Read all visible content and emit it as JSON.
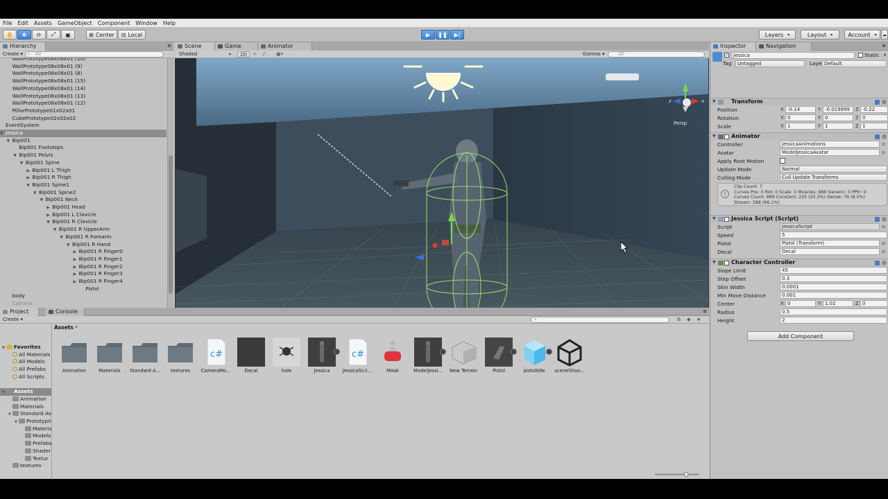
{
  "menu": [
    "File",
    "Edit",
    "Assets",
    "GameObject",
    "Component",
    "Window",
    "Help"
  ],
  "toolbar": {
    "pivot_label": "Center",
    "space_label": "Local",
    "layers_label": "Layers",
    "layout_label": "Layout",
    "account_label": "Account"
  },
  "hierarchy": {
    "tab_label": "Hierarchy",
    "create_label": "Create",
    "search_placeholder": "All",
    "rows": [
      {
        "label": "WallPrototype08x08x01 (10)",
        "indent": 1
      },
      {
        "label": "WallPrototype08x08x01 (9)",
        "indent": 1
      },
      {
        "label": "WallPrototype08x08x01 (8)",
        "indent": 1
      },
      {
        "label": "WallPrototype08x08x01 (15)",
        "indent": 1
      },
      {
        "label": "WallPrototype08x08x01 (14)",
        "indent": 1
      },
      {
        "label": "WallPrototype08x08x01 (13)",
        "indent": 1
      },
      {
        "label": "WallPrototype08x08x01 (12)",
        "indent": 1
      },
      {
        "label": "PillarPrototype01x02x01",
        "indent": 1
      },
      {
        "label": "CubePrototype02x02x02",
        "indent": 1
      },
      {
        "label": "EventSystem",
        "indent": 0
      },
      {
        "label": "Jessica",
        "indent": 0
      },
      {
        "label": "Bip001",
        "indent": 1
      },
      {
        "label": "Bip001 Footsteps",
        "indent": 2
      },
      {
        "label": "Bip001 Pelvis",
        "indent": 2
      },
      {
        "label": "Bip001 Spine",
        "indent": 3
      },
      {
        "label": "Bip001 L Thigh",
        "indent": 4
      },
      {
        "label": "Bip001 R Thigh",
        "indent": 4
      },
      {
        "label": "Bip001 Spine1",
        "indent": 4
      },
      {
        "label": "Bip001 Spine2",
        "indent": 5
      },
      {
        "label": "Bip001 Neck",
        "indent": 6
      },
      {
        "label": "Bip001 Head",
        "indent": 7
      },
      {
        "label": "Bip001 L Clavicle",
        "indent": 7
      },
      {
        "label": "Bip001 R Clavicle",
        "indent": 7
      },
      {
        "label": "Bip001 R UpperArm",
        "indent": 8
      },
      {
        "label": "Bip001 R Forearm",
        "indent": 9
      },
      {
        "label": "Bip001 R Hand",
        "indent": 10
      },
      {
        "label": "Bip001 R Finger0",
        "indent": 11
      },
      {
        "label": "Bip001 R Finger1",
        "indent": 11
      },
      {
        "label": "Bip001 R Finger2",
        "indent": 11
      },
      {
        "label": "Bip001 R Finger3",
        "indent": 11
      },
      {
        "label": "Bip001 R Finger4",
        "indent": 11
      },
      {
        "label": "Pistol",
        "indent": 12
      },
      {
        "label": "body",
        "indent": 1
      },
      {
        "label": "Camera",
        "indent": 1
      }
    ],
    "selected": "Jessica"
  },
  "scene": {
    "tabs": [
      "Scene",
      "Game",
      "Animator"
    ],
    "shading": "Shaded",
    "mode_2d": "2D",
    "gizmos_label": "Gizmos",
    "search_placeholder": "All",
    "persp_label": "Persp"
  },
  "inspector": {
    "tabs": [
      "Inspector",
      "Navigation"
    ],
    "object_name": "Jessica",
    "static_label": "Static",
    "tag_label": "Tag",
    "tag_value": "Untagged",
    "layer_label": "Layer",
    "layer_value": "Default",
    "transform": {
      "title": "Transform",
      "position_label": "Position",
      "position": [
        "-0.14",
        "-0.019899",
        "-0.22"
      ],
      "rotation_label": "Rotation",
      "rotation": [
        "0",
        "0",
        "0"
      ],
      "scale_label": "Scale",
      "scale": [
        "1",
        "1",
        "1"
      ]
    },
    "animator": {
      "title": "Animator",
      "controller_label": "Controller",
      "controller_value": "JessicaAnimations",
      "avatar_label": "Avatar",
      "avatar_value": "ModelJessicaAvatar",
      "apply_root_label": "Apply Root Motion",
      "update_mode_label": "Update Mode",
      "update_mode_value": "Normal",
      "culling_label": "Culling Mode",
      "culling_value": "Cull Update Transforms",
      "info_lines": [
        "Clip Count: 7",
        "Curves Pos: 0 Rot: 0 Scale: 0 Muscles: 889 Generic: 0 PPtr: 0",
        "Curves Count: 889 Constant: 225 (25.3%) Dense: 76 (8.5%)",
        "Stream: 588 (66.1%)"
      ]
    },
    "script": {
      "title": "Jessica Script (Script)",
      "script_label": "Script",
      "script_value": "JessicaScript",
      "speed_label": "Speed",
      "speed_value": "5",
      "pistol_label": "Pistol",
      "pistol_value": "Pistol (Transform)",
      "decal_label": "Decal",
      "decal_value": "Decal"
    },
    "cc": {
      "title": "Character Controller",
      "slope_label": "Slope Limit",
      "slope_value": "45",
      "step_label": "Step Offset",
      "step_value": "0.3",
      "skin_label": "Skin Width",
      "skin_value": "0.0001",
      "minmove_label": "Min Move Distance",
      "minmove_value": "0.001",
      "center_label": "Center",
      "center": [
        "0",
        "1.02",
        "0"
      ],
      "radius_label": "Radius",
      "radius_value": "0.5",
      "height_label": "Height",
      "height_value": "2"
    },
    "add_component_label": "Add Component"
  },
  "project": {
    "tabs": [
      "Project",
      "Console"
    ],
    "create_label": "Create",
    "breadcrumb": "Assets",
    "tree": [
      {
        "label": "Favorites",
        "indent": 0,
        "bold": true
      },
      {
        "label": "All Materials",
        "indent": 1
      },
      {
        "label": "All Models",
        "indent": 1
      },
      {
        "label": "All Prefabs",
        "indent": 1
      },
      {
        "label": "All Scripts",
        "indent": 1
      },
      {
        "label": "",
        "indent": 0
      },
      {
        "label": "Assets",
        "indent": 0,
        "bold": true,
        "highlight": true
      },
      {
        "label": "Animation",
        "indent": 1
      },
      {
        "label": "Materials",
        "indent": 1
      },
      {
        "label": "Standard As",
        "indent": 1
      },
      {
        "label": "Prototypin",
        "indent": 2
      },
      {
        "label": "Materia",
        "indent": 3
      },
      {
        "label": "Models",
        "indent": 3
      },
      {
        "label": "Prefabs",
        "indent": 3
      },
      {
        "label": "Shader",
        "indent": 3
      },
      {
        "label": "Textur",
        "indent": 3
      },
      {
        "label": "textures",
        "indent": 1
      }
    ],
    "assets": [
      {
        "label": "Animation",
        "kind": "folder"
      },
      {
        "label": "Materials",
        "kind": "folder"
      },
      {
        "label": "Standard A...",
        "kind": "folder"
      },
      {
        "label": "textures",
        "kind": "folder"
      },
      {
        "label": "CameraMo...",
        "kind": "script"
      },
      {
        "label": "Decal",
        "kind": "dark"
      },
      {
        "label": "hole",
        "kind": "hole"
      },
      {
        "label": "Jessica",
        "kind": "model"
      },
      {
        "label": "JessicaScri...",
        "kind": "script"
      },
      {
        "label": "MAsk",
        "kind": "mask"
      },
      {
        "label": "ModelJessi...",
        "kind": "model"
      },
      {
        "label": "New Terrain",
        "kind": "terrain"
      },
      {
        "label": "Pistol",
        "kind": "pistol"
      },
      {
        "label": "pistolIdle",
        "kind": "cube"
      },
      {
        "label": "sceneShoo...",
        "kind": "unity"
      }
    ]
  },
  "colors": {
    "accent": "#3f84d6",
    "selection": "#8e8e8e",
    "panel": "#c2c2c2",
    "collider": "#9ef06a"
  }
}
